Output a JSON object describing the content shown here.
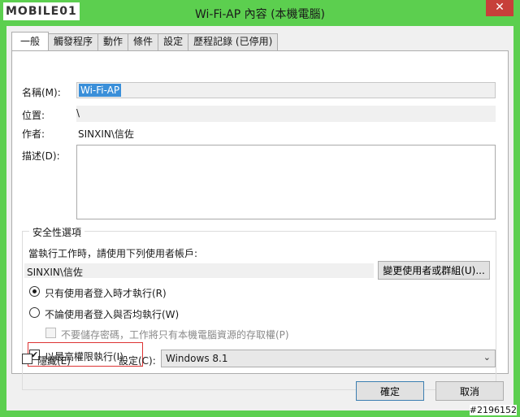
{
  "logo": "MOBILE01",
  "window": {
    "title": "Wi-Fi-AP 內容 (本機電腦)",
    "close_glyph": "✕"
  },
  "tabs": [
    {
      "label": "一般",
      "active": true
    },
    {
      "label": "觸發程序",
      "active": false
    },
    {
      "label": "動作",
      "active": false
    },
    {
      "label": "條件",
      "active": false
    },
    {
      "label": "設定",
      "active": false
    },
    {
      "label": "歷程記錄 (已停用)",
      "active": false
    }
  ],
  "general": {
    "name_label": "名稱(M):",
    "name_value": "Wi-Fi-AP",
    "location_label": "位置:",
    "location_value": "\\",
    "author_label": "作者:",
    "author_value": "SINXIN\\信佐",
    "description_label": "描述(D):",
    "description_value": ""
  },
  "security": {
    "legend": "安全性選項",
    "run_as_prompt": "當執行工作時，請使用下列使用者帳戶:",
    "user_account": "SINXIN\\信佐",
    "change_user_button": "變更使用者或群組(U)...",
    "radio_logged_on": "只有使用者登入時才執行(R)",
    "radio_logged_on_selected": true,
    "radio_whether": "不論使用者登入與否均執行(W)",
    "dont_store_password": "不要儲存密碼，工作將只有本機電腦資源的存取權(P)",
    "highest_privileges": "以最高權限執行(I)",
    "highest_privileges_checked": true,
    "check_glyph": "✔"
  },
  "footer": {
    "hidden_label": "隱藏(E)",
    "configure_label": "設定(C):",
    "configure_value": "Windows 8.1",
    "ok_button": "確定",
    "cancel_button": "取消",
    "arrow_glyph": "⌄"
  },
  "watermark": "#2196152",
  "colors": {
    "title_bar": "#5ccf4f",
    "close_button": "#c7403a",
    "selection": "#3a8fd9",
    "highlight_border": "#dd3333"
  }
}
